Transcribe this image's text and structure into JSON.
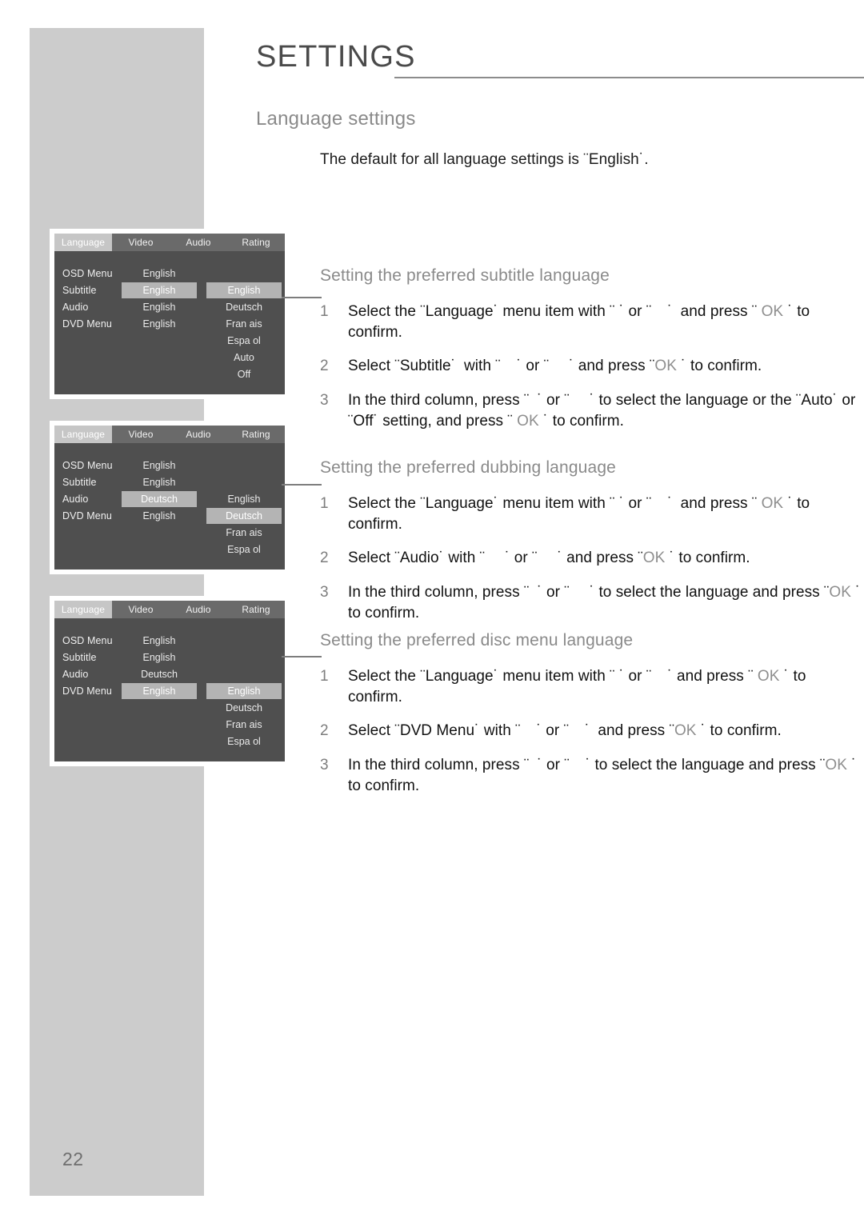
{
  "page": {
    "title": "SETTINGS",
    "number": "22"
  },
  "section": {
    "heading": "Language settings",
    "lead": "The default for all language settings is ¨English˙."
  },
  "blocks": [
    {
      "heading": "Setting the preferred subtitle language",
      "steps": [
        {
          "num": "1",
          "text": "Select the ¨Language˙ menu item with ¨ ˙ or ¨    ˙  and press ¨ OK ˙ to confirm."
        },
        {
          "num": "2",
          "text": "Select ¨Subtitle˙  with ¨    ˙ or ¨     ˙ and press ¨OK ˙ to confirm."
        },
        {
          "num": "3",
          "text": "In the third column, press ¨  ˙ or ¨     ˙ to select the language or the ¨Auto˙ or ¨Off˙ setting, and press ¨ OK ˙ to confirm."
        }
      ]
    },
    {
      "heading": "Setting the preferred dubbing language",
      "steps": [
        {
          "num": "1",
          "text": "Select the ¨Language˙ menu item with ¨ ˙ or ¨    ˙  and press ¨ OK ˙ to confirm."
        },
        {
          "num": "2",
          "text": "Select ¨Audio˙ with ¨     ˙ or ¨     ˙ and press ¨OK ˙ to confirm."
        },
        {
          "num": "3",
          "text": "In the third column, press ¨  ˙ or ¨     ˙ to select the language and press ¨OK ˙ to confirm."
        }
      ]
    },
    {
      "heading": "Setting the preferred disc menu language",
      "steps": [
        {
          "num": "1",
          "text": "Select the ¨Language˙ menu item with ¨ ˙ or ¨    ˙ and press ¨ OK ˙ to confirm."
        },
        {
          "num": "2",
          "text": "Select ¨DVD Menu˙ with ¨    ˙ or ¨    ˙  and press ¨OK ˙ to confirm."
        },
        {
          "num": "3",
          "text": "In the third column, press ¨  ˙ or ¨    ˙ to select the language and press ¨OK ˙ to confirm."
        }
      ]
    }
  ],
  "osd_tabs": [
    "Language",
    "Video",
    "Audio",
    "Rating"
  ],
  "osd_panels": [
    {
      "name": "subtitle",
      "active_tab": "Language",
      "rows": [
        {
          "label": "OSD Menu",
          "value": "English",
          "value_selected": false,
          "option": null,
          "option_selected": false
        },
        {
          "label": "Subtitle",
          "value": "English",
          "value_selected": true,
          "option": "English",
          "option_selected": true
        },
        {
          "label": "Audio",
          "value": "English",
          "value_selected": false,
          "option": "Deutsch",
          "option_selected": false
        },
        {
          "label": "DVD Menu",
          "value": "English",
          "value_selected": false,
          "option": "Fran ais",
          "option_selected": false
        }
      ],
      "extra_options": [
        "Espa ol",
        "Auto",
        "Off"
      ]
    },
    {
      "name": "audio",
      "active_tab": "Language",
      "rows": [
        {
          "label": "OSD Menu",
          "value": "English",
          "value_selected": false,
          "option": null,
          "option_selected": false
        },
        {
          "label": "Subtitle",
          "value": "English",
          "value_selected": false,
          "option": null,
          "option_selected": false
        },
        {
          "label": "Audio",
          "value": "Deutsch",
          "value_selected": true,
          "option": "English",
          "option_selected": false
        },
        {
          "label": "DVD Menu",
          "value": "English",
          "value_selected": false,
          "option": "Deutsch",
          "option_selected": true
        }
      ],
      "extra_options": [
        "Fran ais",
        "Espa ol"
      ]
    },
    {
      "name": "dvd-menu",
      "active_tab": "Language",
      "rows": [
        {
          "label": "OSD Menu",
          "value": "English",
          "value_selected": false,
          "option": null,
          "option_selected": false
        },
        {
          "label": "Subtitle",
          "value": "English",
          "value_selected": false,
          "option": null,
          "option_selected": false
        },
        {
          "label": "Audio",
          "value": "Deutsch",
          "value_selected": false,
          "option": null,
          "option_selected": false
        },
        {
          "label": "DVD Menu",
          "value": "English",
          "value_selected": true,
          "option": "English",
          "option_selected": true
        }
      ],
      "extra_options": [
        "Deutsch",
        "Fran ais",
        "Espa ol"
      ]
    }
  ],
  "colors": {
    "sidebar": "#cccccc",
    "osd_background": "#4f4f4f",
    "osd_tabbar": "#6a6a6a",
    "osd_highlight": "#b4b4b4",
    "heading_gray": "#8a8a8a",
    "rule_gray": "#8c8c8c"
  }
}
